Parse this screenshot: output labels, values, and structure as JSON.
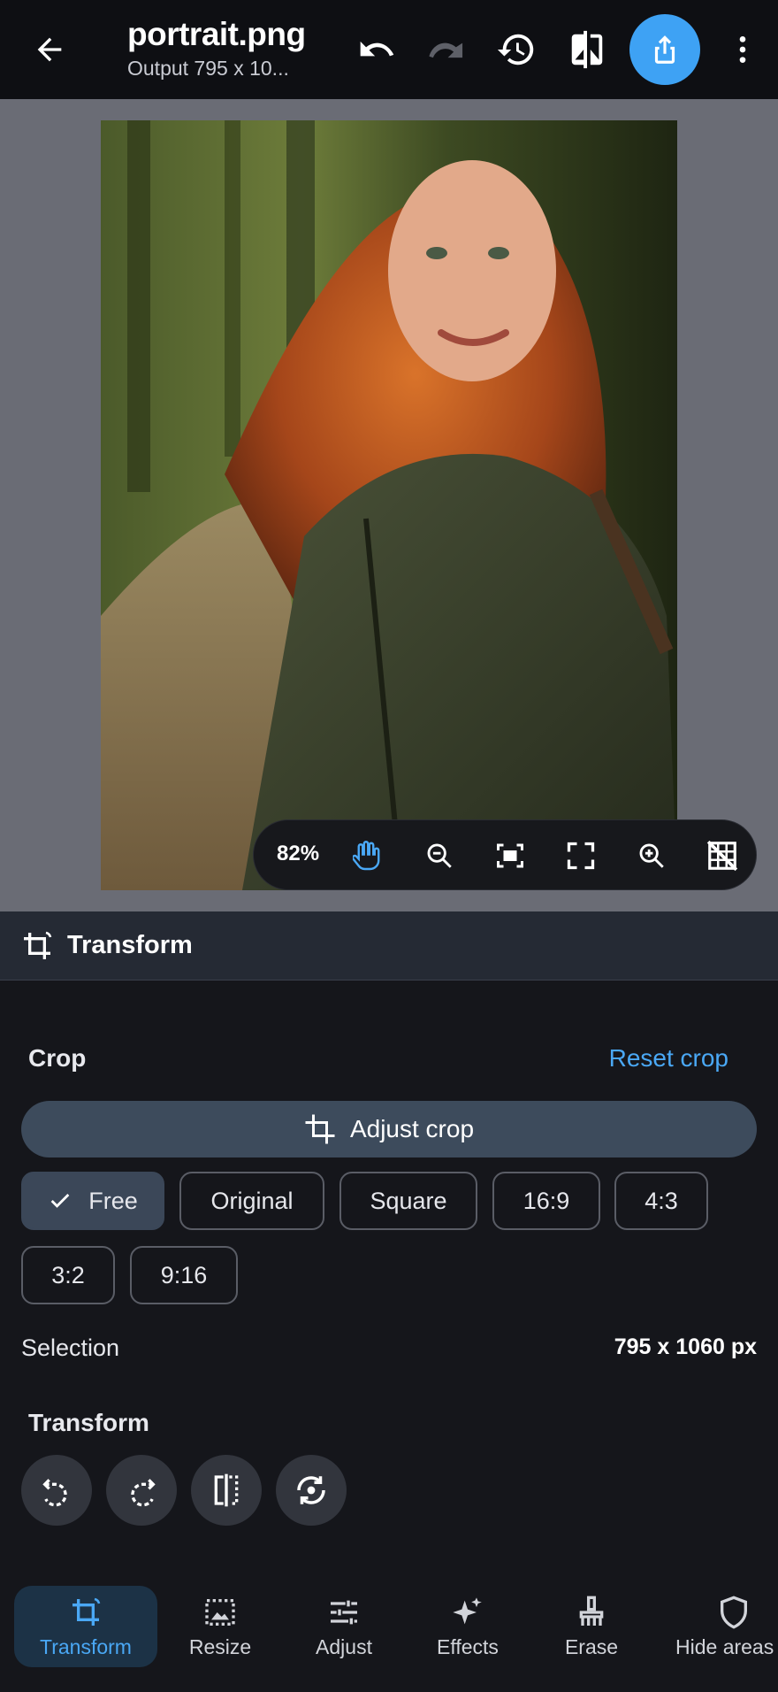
{
  "header": {
    "title": "portrait.png",
    "subtitle": "Output 795 x 10...",
    "back_icon": "arrow-left-icon",
    "undo_icon": "undo-icon",
    "redo_icon": "redo-icon",
    "history_icon": "history-icon",
    "compare_icon": "compare-icon",
    "share_icon": "share-icon",
    "more_icon": "more-vertical-icon",
    "share_color": "#3ea2f4"
  },
  "zoombar": {
    "zoom": "82%",
    "tools": [
      "hand-icon",
      "zoom-out-icon",
      "fit-screen-icon",
      "fullscreen-icon",
      "zoom-in-icon",
      "grid-off-icon"
    ]
  },
  "panel": {
    "title": "Transform",
    "icon": "transform-icon"
  },
  "crop": {
    "label": "Crop",
    "reset_label": "Reset crop",
    "adjust_label": "Adjust crop",
    "ratios": [
      "Free",
      "Original",
      "Square",
      "16:9",
      "4:3",
      "3:2",
      "9:16"
    ],
    "selected_ratio": "Free"
  },
  "selection": {
    "label": "Selection",
    "value": "795 x 1060 px"
  },
  "transform": {
    "label": "Transform",
    "actions": [
      "rotate-left-icon",
      "rotate-right-icon",
      "flip-horizontal-icon",
      "reset-rotation-icon"
    ]
  },
  "nav": {
    "items": [
      {
        "label": "Transform",
        "icon": "transform-icon",
        "active": true
      },
      {
        "label": "Resize",
        "icon": "resize-icon"
      },
      {
        "label": "Adjust",
        "icon": "adjust-icon"
      },
      {
        "label": "Effects",
        "icon": "sparkle-icon"
      },
      {
        "label": "Erase",
        "icon": "brush-icon"
      },
      {
        "label": "Hide areas",
        "icon": "shield-icon"
      }
    ],
    "accent": "#4aa8f5"
  }
}
